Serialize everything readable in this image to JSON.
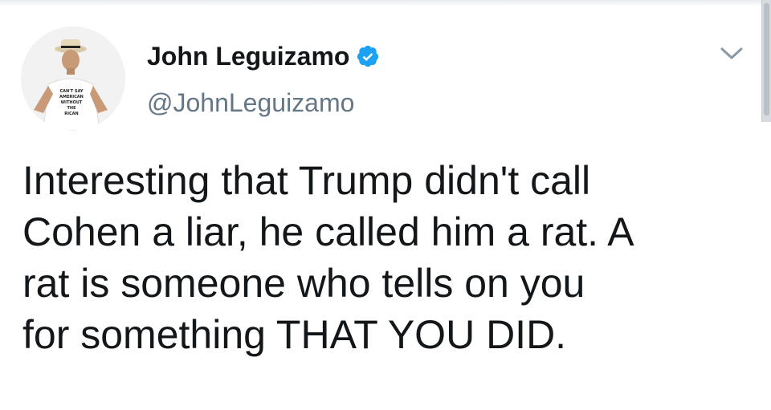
{
  "tweet": {
    "author": {
      "display_name": "John Leguizamo",
      "handle": "@JohnLeguizamo",
      "verified": true,
      "avatar_shirt_text": "CAN'T SAY AMERICAN WITHOUT THE RICAN"
    },
    "text_lines": [
      "Interesting that Trump didn't call",
      "Cohen a liar, he called him a rat. A",
      "rat is someone who tells on you",
      "for something THAT YOU DID."
    ]
  },
  "icons": {
    "verified": "verified-badge-icon",
    "menu": "chevron-down-icon"
  },
  "colors": {
    "verified_blue": "#1da1f2",
    "handle_gray": "#657786",
    "text_black": "#14171a"
  }
}
